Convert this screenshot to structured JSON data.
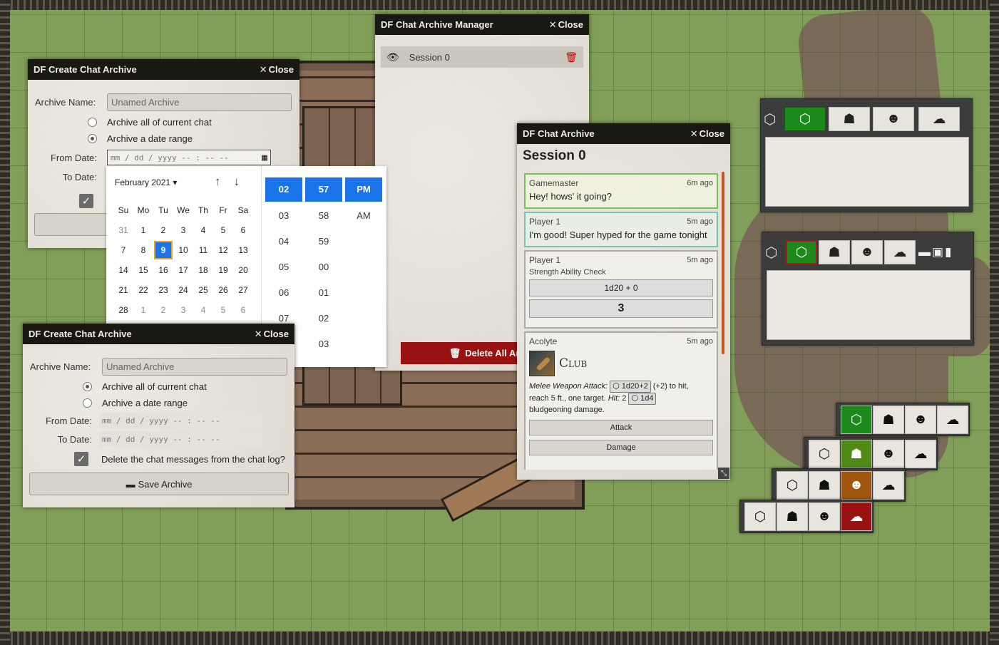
{
  "create_archive_1": {
    "title": "DF Create Chat Archive",
    "close_label": "Close",
    "archive_name_label": "Archive Name:",
    "archive_name_placeholder": "Unamed Archive",
    "option_all": "Archive all of current chat",
    "option_range": "Archive a date range",
    "from_label": "From Date:",
    "to_label": "To Date:",
    "from_value": "mm / dd / yyyy  -- : --  --"
  },
  "date_picker": {
    "month_label": "February 2021 ▾",
    "weekdays": [
      "Su",
      "Mo",
      "Tu",
      "We",
      "Th",
      "Fr",
      "Sa"
    ],
    "weeks": [
      [
        "31",
        "1",
        "2",
        "3",
        "4",
        "5",
        "6"
      ],
      [
        "7",
        "8",
        "9",
        "10",
        "11",
        "12",
        "13"
      ],
      [
        "14",
        "15",
        "16",
        "17",
        "18",
        "19",
        "20"
      ],
      [
        "21",
        "22",
        "23",
        "24",
        "25",
        "26",
        "27"
      ],
      [
        "28",
        "1",
        "2",
        "3",
        "4",
        "5",
        "6"
      ]
    ],
    "selected_day": "9",
    "hours": [
      "02",
      "03",
      "04",
      "05",
      "06",
      "07"
    ],
    "minutes": [
      "57",
      "58",
      "59",
      "00",
      "01",
      "02",
      "03"
    ],
    "ampm": [
      "PM",
      "AM"
    ]
  },
  "create_archive_2": {
    "title": "DF Create Chat Archive",
    "close_label": "Close",
    "archive_name_label": "Archive Name:",
    "archive_name_placeholder": "Unamed Archive",
    "option_all": "Archive all of current chat",
    "option_range": "Archive a date range",
    "from_label": "From Date:",
    "to_label": "To Date:",
    "from_value": "mm / dd / yyyy  -- : --  --",
    "to_value": "mm / dd / yyyy  -- : --  --",
    "delete_label": "Delete the chat messages from the chat log?",
    "save_label": "Save Archive"
  },
  "archive_manager": {
    "title": "DF Chat Archive Manager",
    "close_label": "Close",
    "session_name": "Session 0",
    "delete_all_label": "Delete All Archiv"
  },
  "chat_archive": {
    "title": "DF Chat Archive",
    "close_label": "Close",
    "session_title": "Session 0",
    "messages": [
      {
        "who": "Gamemaster",
        "ago": "6m ago",
        "text": "Hey! hows' it going?"
      },
      {
        "who": "Player 1",
        "ago": "5m ago",
        "text": "I'm good! Super hyped for the game tonight"
      },
      {
        "who": "Player 1",
        "ago": "5m ago",
        "flavor": "Strength Ability Check",
        "formula": "1d20 + 0",
        "total": "3"
      },
      {
        "who": "Acolyte",
        "ago": "5m ago",
        "item": "Club",
        "attack_label": "Melee Weapon Attack:",
        "attack_roll": "1d20+2",
        "attack_text_1": "(+2) to hit,",
        "attack_text_2": "reach 5 ft., one target.",
        "hit_label": "Hit:",
        "hit_value": "2",
        "hit_roll": "1d4",
        "attack_text_3": "bludgeoning damage.",
        "button_attack": "Attack",
        "button_damage": "Damage"
      }
    ]
  },
  "icons": {
    "d20": "⬡",
    "spy": "☗",
    "user": "☻",
    "ghost": "☁",
    "archive": "▬",
    "save": "▣",
    "trash": "✖"
  },
  "colors": {
    "green": "#1b8a1b",
    "olive": "#4f8a16",
    "brown": "#a0560f",
    "red": "#9a1111",
    "delete_button": "#9a1111",
    "header": "#191813"
  }
}
